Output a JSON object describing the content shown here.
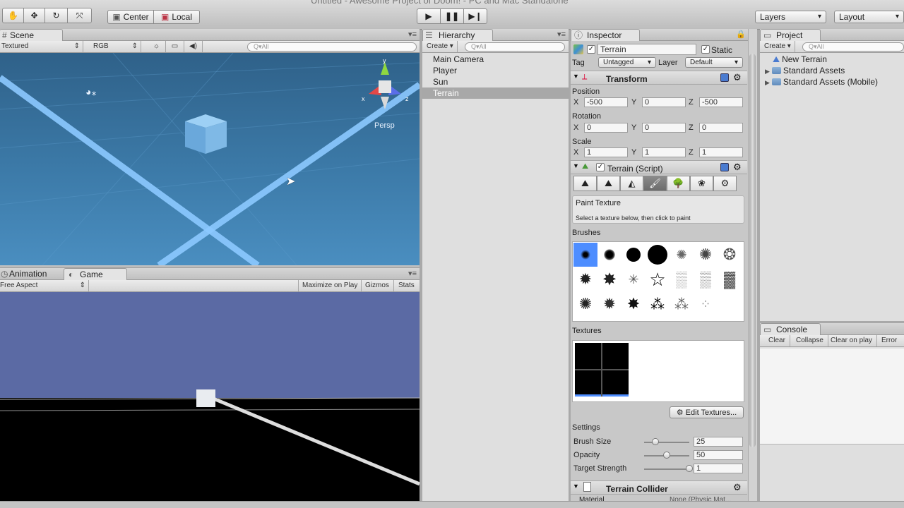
{
  "window": {
    "title": "Untitled - Awesome Project of Doom! - PC and Mac Standalone"
  },
  "toolbar": {
    "pivot_label": "Center",
    "space_label": "Local",
    "layers_label": "Layers",
    "layout_label": "Layout"
  },
  "scene": {
    "tab": "Scene",
    "render_mode": "Textured",
    "color_mode": "RGB",
    "search_placeholder": "Q▾All",
    "view_label": "Persp",
    "gizmo_axes": [
      "y",
      "x",
      "z"
    ]
  },
  "game": {
    "tabs": [
      "Animation",
      "Game"
    ],
    "aspect": "Free Aspect",
    "maximize_label": "Maximize on Play",
    "gizmos_label": "Gizmos",
    "stats_label": "Stats"
  },
  "hierarchy": {
    "tab": "Hierarchy",
    "create_label": "Create ▾",
    "search_placeholder": "Q▾All",
    "items": [
      "Main Camera",
      "Player",
      "Sun",
      "Terrain"
    ],
    "selected": "Terrain"
  },
  "inspector": {
    "tab": "Inspector",
    "object_name": "Terrain",
    "static_label": "Static",
    "tag_label": "Tag",
    "tag_value": "Untagged",
    "layer_label": "Layer",
    "layer_value": "Default",
    "transform": {
      "title": "Transform",
      "position_label": "Position",
      "rotation_label": "Rotation",
      "scale_label": "Scale",
      "axis_labels": [
        "X",
        "Y",
        "Z"
      ],
      "position": [
        "-500",
        "0",
        "-500"
      ],
      "rotation": [
        "0",
        "0",
        "0"
      ],
      "scale": [
        "1",
        "1",
        "1"
      ]
    },
    "terrain": {
      "title": "Terrain (Script)",
      "tool_icons": [
        "raise-lower-icon",
        "paint-height-icon",
        "smooth-height-icon",
        "paint-texture-icon",
        "place-trees-icon",
        "paint-details-icon",
        "terrain-settings-icon"
      ],
      "active_tool_index": 3,
      "tool_title": "Paint Texture",
      "tool_hint": "Select a texture below, then click to paint",
      "brushes_label": "Brushes",
      "textures_label": "Textures",
      "edit_textures_label": "⚙ Edit Textures...",
      "settings_label": "Settings",
      "brush_size_label": "Brush Size",
      "brush_size": "25",
      "brush_size_fraction": 0.25,
      "opacity_label": "Opacity",
      "opacity": "50",
      "opacity_fraction": 0.5,
      "target_strength_label": "Target Strength",
      "target_strength": "1",
      "target_strength_fraction": 1.0
    },
    "collider": {
      "title": "Terrain Collider",
      "material_label": "Material",
      "material_value": "None (Physic Mat..."
    }
  },
  "project": {
    "tab": "Project",
    "create_label": "Create ▾",
    "search_placeholder": "Q▾All",
    "items": [
      "New Terrain",
      "Standard Assets",
      "Standard Assets (Mobile)"
    ]
  },
  "console": {
    "tab": "Console",
    "buttons": [
      "Clear",
      "Collapse",
      "Clear on play",
      "Error p"
    ]
  }
}
